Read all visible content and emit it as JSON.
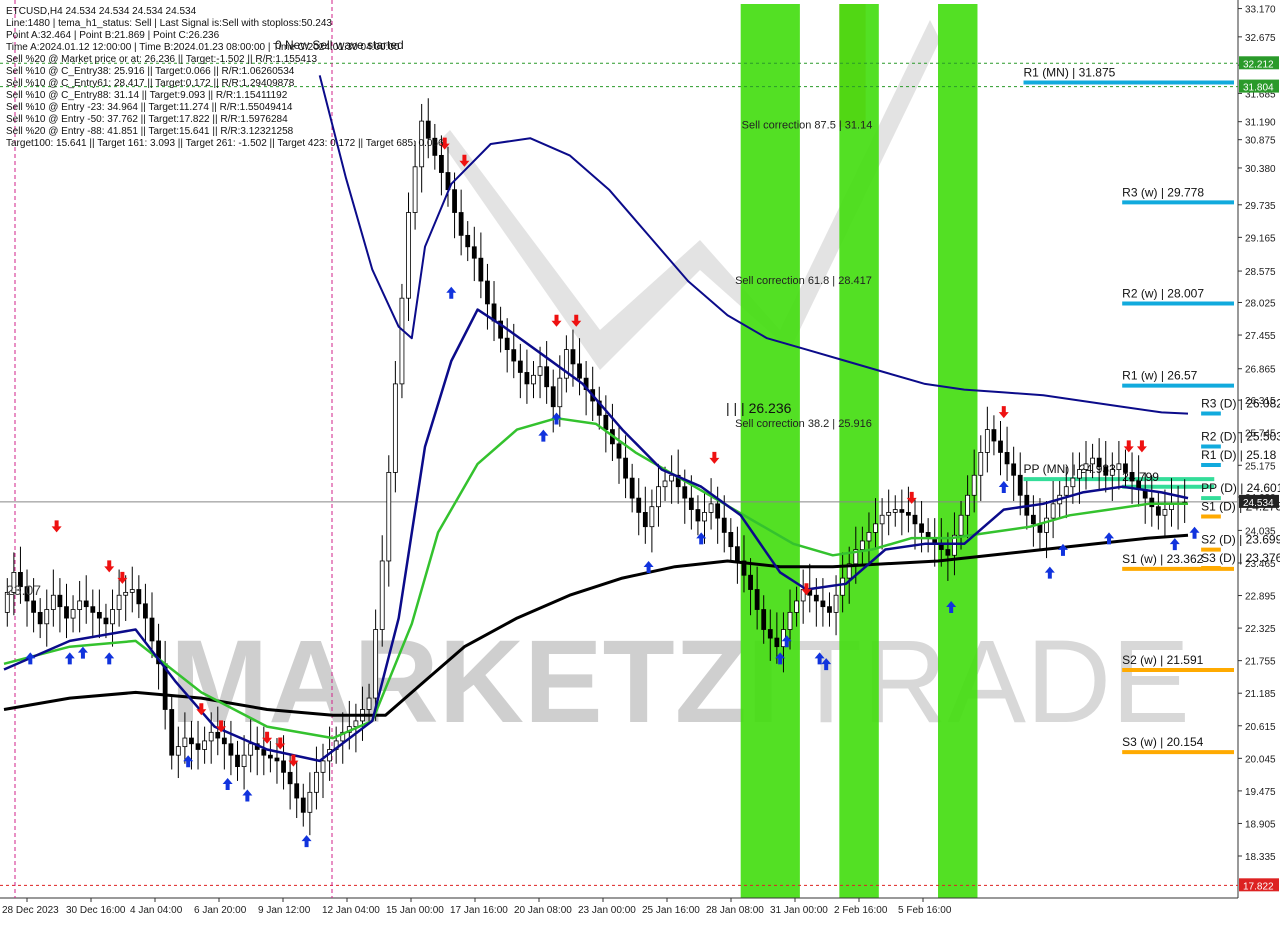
{
  "info_lines": [
    "ETCUSD,H4  24.534 24.534 24.534 24.534",
    "Line:1480 | tema_h1_status: Sell | Last Signal is:Sell with stoploss:50.243",
    "Point A:32.464 | Point B:21.869 | Point C:26.236",
    "Time A:2024.01.12 12:00:00 | Time B:2024.01.23 08:00:00 | Time C:2024.01.30 04:00:00",
    "Sell %20 @ Market price or at: 26.236 || Target:-1.502 || R/R:1.155413",
    "Sell %10 @ C_Entry38: 25.916 || Target:0.066 || R/R:1.06260534",
    "Sell %10 @ C_Entry61: 28.417 || Target:0.172 || R/R:1.29409878",
    "Sell %10 @ C_Entry88: 31.14 || Target:9.093 || R/R:1.15411192",
    "Sell %10 @ Entry -23: 34.964 || Target:11.274 || R/R:1.55049414",
    "Sell %10 @ Entry -50: 37.762 || Target:17.822 || R/R:1.5976284",
    "Sell %20 @ Entry -88: 41.851 || Target:15.641 || R/R:3.12321258",
    "Target100: 15.641 || Target 161: 3.093 || Target 261: -1.502 || Target 423: 0.172 || Target 685: 0.066"
  ],
  "wave_label": "0 New Sell wave started",
  "high_label": "| | | 26.236",
  "left_price_label": "23.07",
  "watermark": {
    "a": "MARKETZI",
    "b": "TRADE"
  },
  "colors": {
    "candle": "#000000",
    "ma_blue": "#0b0b8a",
    "ma_green": "#34c22e",
    "ma_black": "#000000",
    "zone_green": "#44dd11",
    "zone_orange": "#dd8833",
    "arrow_buy": "#1133dd",
    "arrow_sell": "#ee1111",
    "level_blue": "#11aadd",
    "level_orange": "#ffaa00",
    "pp_green": "#33dd99",
    "marker_green": "#2a9a2a",
    "marker_red": "#dd2222",
    "marker_dark": "#222222"
  },
  "chart_data": {
    "type": "candlestick",
    "symbol": "ETCUSD",
    "timeframe": "H4",
    "ylim": [
      17.6,
      33.25
    ],
    "y_ticks": [
      "33.170",
      "32.675",
      "32.180",
      "31.685",
      "31.190",
      "30.875",
      "30.380",
      "29.735",
      "29.165",
      "28.575",
      "28.025",
      "27.455",
      "26.865",
      "26.315",
      "25.745",
      "25.175",
      "24.620",
      "24.035",
      "23.465",
      "22.895",
      "22.325",
      "21.755",
      "21.185",
      "20.615",
      "20.045",
      "19.475",
      "18.905",
      "18.335"
    ],
    "x_ticks": [
      "28 Dec 2023",
      "30 Dec 16:00",
      "4 Jan 04:00",
      "6 Jan 20:00",
      "9 Jan 12:00",
      "12 Jan 04:00",
      "15 Jan 00:00",
      "17 Jan 16:00",
      "20 Jan 08:00",
      "23 Jan 00:00",
      "25 Jan 16:00",
      "28 Jan 08:00",
      "31 Jan 00:00",
      "2 Feb 16:00",
      "5 Feb 16:00"
    ],
    "price_markers": [
      {
        "label": "32.212",
        "value": 32.212,
        "kind": "green"
      },
      {
        "label": "31.804",
        "value": 31.804,
        "kind": "green"
      },
      {
        "label": "24.534",
        "value": 24.534,
        "kind": "dark"
      },
      {
        "label": "17.822",
        "value": 17.822,
        "kind": "red"
      }
    ],
    "close_series": [
      {
        "x": 0,
        "y": 22.6
      },
      {
        "x": 2,
        "y": 23.3
      },
      {
        "x": 4,
        "y": 22.8
      },
      {
        "x": 6,
        "y": 22.4
      },
      {
        "x": 8,
        "y": 22.9
      },
      {
        "x": 10,
        "y": 22.5
      },
      {
        "x": 12,
        "y": 22.8
      },
      {
        "x": 14,
        "y": 22.6
      },
      {
        "x": 16,
        "y": 22.4
      },
      {
        "x": 18,
        "y": 22.9
      },
      {
        "x": 20,
        "y": 23.0
      },
      {
        "x": 22,
        "y": 22.5
      },
      {
        "x": 24,
        "y": 21.7
      },
      {
        "x": 26,
        "y": 20.1
      },
      {
        "x": 28,
        "y": 20.4
      },
      {
        "x": 30,
        "y": 20.2
      },
      {
        "x": 32,
        "y": 20.5
      },
      {
        "x": 34,
        "y": 20.3
      },
      {
        "x": 36,
        "y": 19.9
      },
      {
        "x": 38,
        "y": 20.3
      },
      {
        "x": 40,
        "y": 20.1
      },
      {
        "x": 42,
        "y": 20.0
      },
      {
        "x": 44,
        "y": 19.6
      },
      {
        "x": 46,
        "y": 19.1
      },
      {
        "x": 48,
        "y": 19.8
      },
      {
        "x": 50,
        "y": 20.2
      },
      {
        "x": 52,
        "y": 20.5
      },
      {
        "x": 54,
        "y": 20.7
      },
      {
        "x": 56,
        "y": 21.1
      },
      {
        "x": 58,
        "y": 23.5
      },
      {
        "x": 60,
        "y": 26.6
      },
      {
        "x": 62,
        "y": 29.6
      },
      {
        "x": 64,
        "y": 31.2
      },
      {
        "x": 66,
        "y": 30.6
      },
      {
        "x": 68,
        "y": 30.0
      },
      {
        "x": 70,
        "y": 29.2
      },
      {
        "x": 72,
        "y": 28.8
      },
      {
        "x": 74,
        "y": 28.0
      },
      {
        "x": 76,
        "y": 27.4
      },
      {
        "x": 78,
        "y": 27.0
      },
      {
        "x": 80,
        "y": 26.6
      },
      {
        "x": 82,
        "y": 26.9
      },
      {
        "x": 84,
        "y": 26.2
      },
      {
        "x": 86,
        "y": 27.2
      },
      {
        "x": 88,
        "y": 26.7
      },
      {
        "x": 90,
        "y": 26.3
      },
      {
        "x": 92,
        "y": 25.8
      },
      {
        "x": 94,
        "y": 25.3
      },
      {
        "x": 96,
        "y": 24.6
      },
      {
        "x": 98,
        "y": 24.1
      },
      {
        "x": 100,
        "y": 24.8
      },
      {
        "x": 102,
        "y": 25.0
      },
      {
        "x": 104,
        "y": 24.6
      },
      {
        "x": 106,
        "y": 24.2
      },
      {
        "x": 108,
        "y": 24.5
      },
      {
        "x": 110,
        "y": 24.0
      },
      {
        "x": 112,
        "y": 23.5
      },
      {
        "x": 114,
        "y": 23.0
      },
      {
        "x": 116,
        "y": 22.3
      },
      {
        "x": 118,
        "y": 22.0
      },
      {
        "x": 120,
        "y": 22.6
      },
      {
        "x": 122,
        "y": 23.0
      },
      {
        "x": 124,
        "y": 22.8
      },
      {
        "x": 126,
        "y": 22.6
      },
      {
        "x": 128,
        "y": 23.2
      },
      {
        "x": 130,
        "y": 23.7
      },
      {
        "x": 132,
        "y": 24.0
      },
      {
        "x": 134,
        "y": 24.3
      },
      {
        "x": 136,
        "y": 24.4
      },
      {
        "x": 138,
        "y": 24.3
      },
      {
        "x": 140,
        "y": 24.0
      },
      {
        "x": 142,
        "y": 23.8
      },
      {
        "x": 144,
        "y": 23.6
      },
      {
        "x": 146,
        "y": 24.3
      },
      {
        "x": 148,
        "y": 25.0
      },
      {
        "x": 150,
        "y": 25.8
      },
      {
        "x": 152,
        "y": 25.4
      },
      {
        "x": 154,
        "y": 25.0
      },
      {
        "x": 156,
        "y": 24.3
      },
      {
        "x": 158,
        "y": 24.0
      },
      {
        "x": 160,
        "y": 24.5
      },
      {
        "x": 162,
        "y": 24.8
      },
      {
        "x": 164,
        "y": 25.1
      },
      {
        "x": 166,
        "y": 25.3
      },
      {
        "x": 168,
        "y": 25.0
      },
      {
        "x": 170,
        "y": 25.2
      },
      {
        "x": 172,
        "y": 24.9
      },
      {
        "x": 174,
        "y": 24.6
      },
      {
        "x": 176,
        "y": 24.3
      },
      {
        "x": 178,
        "y": 24.5
      },
      {
        "x": 180,
        "y": 24.53
      }
    ],
    "ma_blue": [
      {
        "x": 0,
        "y": 21.6
      },
      {
        "x": 10,
        "y": 22.1
      },
      {
        "x": 20,
        "y": 22.3
      },
      {
        "x": 26,
        "y": 21.4
      },
      {
        "x": 32,
        "y": 20.6
      },
      {
        "x": 40,
        "y": 20.2
      },
      {
        "x": 48,
        "y": 20.0
      },
      {
        "x": 56,
        "y": 20.7
      },
      {
        "x": 60,
        "y": 22.5
      },
      {
        "x": 64,
        "y": 25.5
      },
      {
        "x": 68,
        "y": 27.0
      },
      {
        "x": 72,
        "y": 27.9
      },
      {
        "x": 76,
        "y": 27.6
      },
      {
        "x": 82,
        "y": 27.1
      },
      {
        "x": 88,
        "y": 26.6
      },
      {
        "x": 94,
        "y": 25.8
      },
      {
        "x": 100,
        "y": 25.1
      },
      {
        "x": 106,
        "y": 24.8
      },
      {
        "x": 112,
        "y": 24.3
      },
      {
        "x": 118,
        "y": 23.3
      },
      {
        "x": 122,
        "y": 23.0
      },
      {
        "x": 128,
        "y": 23.1
      },
      {
        "x": 134,
        "y": 23.7
      },
      {
        "x": 140,
        "y": 23.8
      },
      {
        "x": 146,
        "y": 23.8
      },
      {
        "x": 152,
        "y": 24.4
      },
      {
        "x": 158,
        "y": 24.5
      },
      {
        "x": 164,
        "y": 24.7
      },
      {
        "x": 170,
        "y": 24.8
      },
      {
        "x": 176,
        "y": 24.7
      },
      {
        "x": 180,
        "y": 24.6
      }
    ],
    "ma_green": [
      {
        "x": 0,
        "y": 21.7
      },
      {
        "x": 10,
        "y": 22.0
      },
      {
        "x": 20,
        "y": 22.1
      },
      {
        "x": 30,
        "y": 21.2
      },
      {
        "x": 40,
        "y": 20.6
      },
      {
        "x": 50,
        "y": 20.4
      },
      {
        "x": 56,
        "y": 20.7
      },
      {
        "x": 62,
        "y": 22.4
      },
      {
        "x": 66,
        "y": 24.0
      },
      {
        "x": 72,
        "y": 25.2
      },
      {
        "x": 78,
        "y": 25.8
      },
      {
        "x": 84,
        "y": 26.0
      },
      {
        "x": 90,
        "y": 25.9
      },
      {
        "x": 96,
        "y": 25.4
      },
      {
        "x": 102,
        "y": 25.0
      },
      {
        "x": 108,
        "y": 24.6
      },
      {
        "x": 114,
        "y": 24.2
      },
      {
        "x": 120,
        "y": 23.8
      },
      {
        "x": 126,
        "y": 23.6
      },
      {
        "x": 132,
        "y": 23.7
      },
      {
        "x": 138,
        "y": 23.9
      },
      {
        "x": 144,
        "y": 23.9
      },
      {
        "x": 150,
        "y": 24.0
      },
      {
        "x": 156,
        "y": 24.1
      },
      {
        "x": 162,
        "y": 24.3
      },
      {
        "x": 168,
        "y": 24.4
      },
      {
        "x": 174,
        "y": 24.5
      },
      {
        "x": 180,
        "y": 24.5
      }
    ],
    "ma_black": [
      {
        "x": 0,
        "y": 20.9
      },
      {
        "x": 10,
        "y": 21.1
      },
      {
        "x": 20,
        "y": 21.2
      },
      {
        "x": 30,
        "y": 21.1
      },
      {
        "x": 40,
        "y": 20.9
      },
      {
        "x": 50,
        "y": 20.8
      },
      {
        "x": 58,
        "y": 20.8
      },
      {
        "x": 64,
        "y": 21.4
      },
      {
        "x": 70,
        "y": 22.0
      },
      {
        "x": 78,
        "y": 22.5
      },
      {
        "x": 86,
        "y": 22.9
      },
      {
        "x": 94,
        "y": 23.2
      },
      {
        "x": 102,
        "y": 23.4
      },
      {
        "x": 110,
        "y": 23.5
      },
      {
        "x": 118,
        "y": 23.4
      },
      {
        "x": 126,
        "y": 23.4
      },
      {
        "x": 134,
        "y": 23.45
      },
      {
        "x": 142,
        "y": 23.5
      },
      {
        "x": 150,
        "y": 23.6
      },
      {
        "x": 158,
        "y": 23.7
      },
      {
        "x": 166,
        "y": 23.8
      },
      {
        "x": 174,
        "y": 23.9
      },
      {
        "x": 180,
        "y": 23.95
      }
    ],
    "ma_slow_blue": [
      {
        "x": 48,
        "y": 32.0
      },
      {
        "x": 52,
        "y": 30.2
      },
      {
        "x": 56,
        "y": 28.6
      },
      {
        "x": 60,
        "y": 27.6
      },
      {
        "x": 62,
        "y": 27.4
      },
      {
        "x": 64,
        "y": 29.0
      },
      {
        "x": 68,
        "y": 30.1
      },
      {
        "x": 74,
        "y": 30.8
      },
      {
        "x": 80,
        "y": 30.9
      },
      {
        "x": 86,
        "y": 30.6
      },
      {
        "x": 92,
        "y": 30.0
      },
      {
        "x": 98,
        "y": 29.2
      },
      {
        "x": 104,
        "y": 28.4
      },
      {
        "x": 110,
        "y": 27.8
      },
      {
        "x": 116,
        "y": 27.4
      },
      {
        "x": 122,
        "y": 27.2
      },
      {
        "x": 128,
        "y": 27.0
      },
      {
        "x": 134,
        "y": 26.8
      },
      {
        "x": 140,
        "y": 26.6
      },
      {
        "x": 146,
        "y": 26.5
      },
      {
        "x": 152,
        "y": 26.45
      },
      {
        "x": 158,
        "y": 26.4
      },
      {
        "x": 164,
        "y": 26.3
      },
      {
        "x": 170,
        "y": 26.2
      },
      {
        "x": 176,
        "y": 26.1
      },
      {
        "x": 180,
        "y": 26.08
      }
    ],
    "zones": [
      {
        "from": 112,
        "to": 121,
        "color": "green"
      },
      {
        "from": 127,
        "to": 131,
        "color": "orange_top",
        "orange_to": 31.1
      },
      {
        "from": 127,
        "to": 133,
        "color": "green"
      },
      {
        "from": 142,
        "to": 148,
        "color": "green"
      }
    ],
    "levels": [
      {
        "label": "R1 (MN) | 31.875",
        "value": 31.875,
        "from": 155,
        "to": 187,
        "kind": "blue"
      },
      {
        "label": "R3 (w) | 29.778",
        "value": 29.778,
        "from": 170,
        "to": 187,
        "kind": "blue"
      },
      {
        "label": "R2 (w) | 28.007",
        "value": 28.007,
        "from": 170,
        "to": 187,
        "kind": "blue"
      },
      {
        "label": "R1 (w) | 26.57",
        "value": 26.57,
        "from": 170,
        "to": 187,
        "kind": "blue"
      },
      {
        "label": "R3 (D) | 26.082",
        "value": 26.082,
        "from": 182,
        "to": 185,
        "kind": "blue"
      },
      {
        "label": "R2 (D) | 25.503",
        "value": 25.503,
        "from": 182,
        "to": 185,
        "kind": "blue"
      },
      {
        "label": "R1 (D) | 25.18",
        "value": 25.18,
        "from": 182,
        "to": 185,
        "kind": "blue"
      },
      {
        "label": "PP (MN) | 24.933",
        "value": 24.933,
        "from": 155,
        "to": 184,
        "kind": "pp"
      },
      {
        "label": "24.799",
        "value": 24.799,
        "from": 170,
        "to": 184,
        "kind": "pp"
      },
      {
        "label": "PP (D) | 24.601",
        "value": 24.601,
        "from": 182,
        "to": 185,
        "kind": "pp"
      },
      {
        "label": "S1 (D) | 24.278",
        "value": 24.278,
        "from": 182,
        "to": 185,
        "kind": "orange"
      },
      {
        "label": "S2 (D) | 23.699",
        "value": 23.699,
        "from": 182,
        "to": 185,
        "kind": "orange"
      },
      {
        "label": "S3 (D) | 23.376",
        "value": 23.376,
        "from": 182,
        "to": 185,
        "kind": "orange"
      },
      {
        "label": "S1 (w) | 23.362",
        "value": 23.362,
        "from": 170,
        "to": 187,
        "kind": "orange"
      },
      {
        "label": "S2 (w) | 21.591",
        "value": 21.591,
        "from": 170,
        "to": 187,
        "kind": "orange"
      },
      {
        "label": "S3 (w) | 20.154",
        "value": 20.154,
        "from": 170,
        "to": 187,
        "kind": "orange"
      }
    ],
    "corrections": [
      {
        "label": "Sell correction 87.5 | 31.14",
        "value": 31.14,
        "x": 112
      },
      {
        "label": "Sell correction 61.8 | 28.417",
        "value": 28.417,
        "x": 111
      },
      {
        "label": "Sell correction 38.2 | 25.916",
        "value": 25.916,
        "x": 111
      }
    ],
    "buy_arrows": [
      {
        "x": 4,
        "y": 21.9
      },
      {
        "x": 10,
        "y": 21.9
      },
      {
        "x": 12,
        "y": 22.0
      },
      {
        "x": 16,
        "y": 21.9
      },
      {
        "x": 28,
        "y": 20.1
      },
      {
        "x": 34,
        "y": 19.7
      },
      {
        "x": 37,
        "y": 19.5
      },
      {
        "x": 46,
        "y": 18.7
      },
      {
        "x": 68,
        "y": 28.3
      },
      {
        "x": 82,
        "y": 25.8
      },
      {
        "x": 84,
        "y": 26.1
      },
      {
        "x": 98,
        "y": 23.5
      },
      {
        "x": 106,
        "y": 24.0
      },
      {
        "x": 118,
        "y": 21.9
      },
      {
        "x": 119,
        "y": 22.2
      },
      {
        "x": 124,
        "y": 21.9
      },
      {
        "x": 125,
        "y": 21.8
      },
      {
        "x": 144,
        "y": 22.8
      },
      {
        "x": 152,
        "y": 24.9
      },
      {
        "x": 159,
        "y": 23.4
      },
      {
        "x": 161,
        "y": 23.8
      },
      {
        "x": 168,
        "y": 24.0
      },
      {
        "x": 178,
        "y": 23.9
      },
      {
        "x": 181,
        "y": 24.1
      }
    ],
    "sell_arrows": [
      {
        "x": 8,
        "y": 24.0
      },
      {
        "x": 16,
        "y": 23.3
      },
      {
        "x": 18,
        "y": 23.1
      },
      {
        "x": 30,
        "y": 20.8
      },
      {
        "x": 33,
        "y": 20.5
      },
      {
        "x": 40,
        "y": 20.3
      },
      {
        "x": 42,
        "y": 20.2
      },
      {
        "x": 44,
        "y": 19.9
      },
      {
        "x": 67,
        "y": 30.7
      },
      {
        "x": 70,
        "y": 30.4
      },
      {
        "x": 84,
        "y": 27.6
      },
      {
        "x": 87,
        "y": 27.6
      },
      {
        "x": 108,
        "y": 25.2
      },
      {
        "x": 122,
        "y": 22.9
      },
      {
        "x": 138,
        "y": 24.5
      },
      {
        "x": 152,
        "y": 26.0
      },
      {
        "x": 171,
        "y": 25.4
      },
      {
        "x": 173,
        "y": 25.4
      }
    ]
  }
}
